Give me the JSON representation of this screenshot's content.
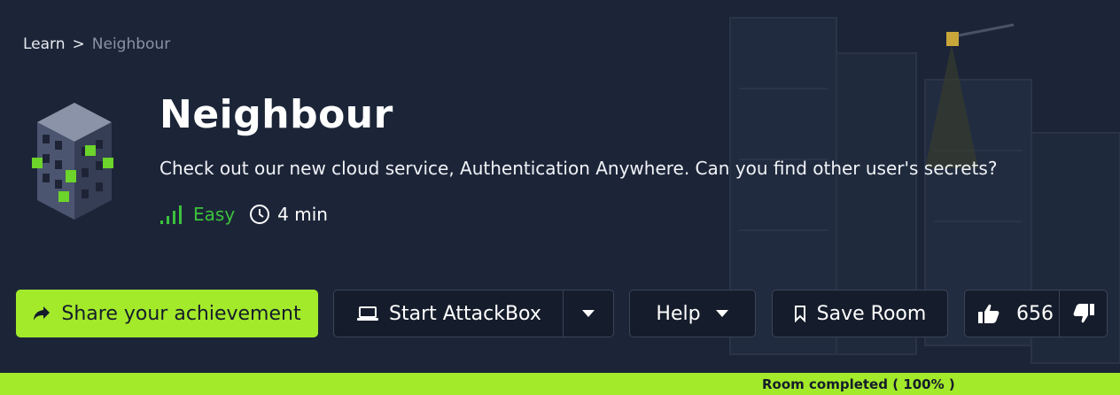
{
  "breadcrumb": {
    "root": "Learn",
    "separator": ">",
    "current": "Neighbour"
  },
  "room": {
    "title": "Neighbour",
    "description": "Check out our new cloud service, Authentication Anywhere. Can you find other user's secrets?",
    "difficulty": "Easy",
    "duration": "4 min",
    "icon": "building-icon"
  },
  "actions": {
    "share_label": "Share your achievement",
    "attackbox_label": "Start AttackBox",
    "help_label": "Help",
    "save_label": "Save Room",
    "upvotes": "656"
  },
  "progress": {
    "label": "Room completed ( 100% )",
    "percent": 100
  },
  "colors": {
    "background": "#1c2538",
    "accent": "#a3ea2a",
    "easy": "#3bc23b",
    "button_bg": "#151c2b",
    "border": "#3a4458"
  }
}
